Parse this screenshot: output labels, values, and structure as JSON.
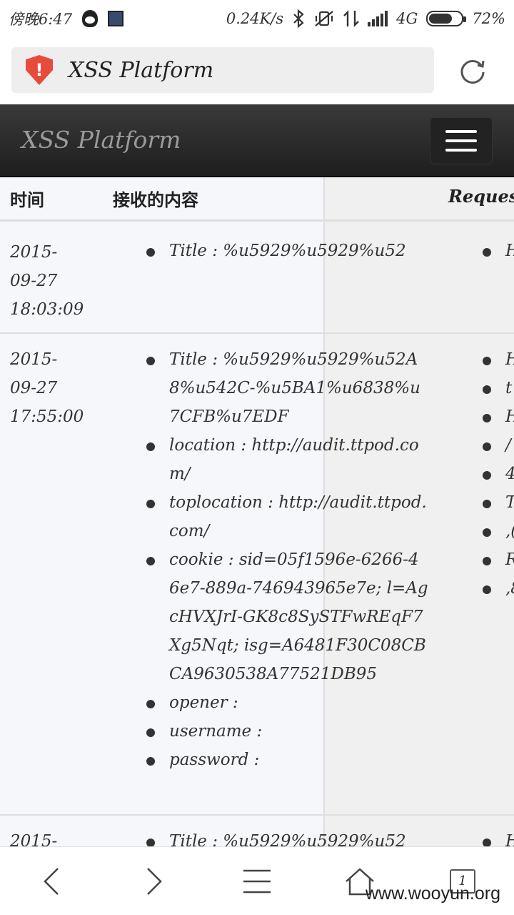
{
  "status_bar": {
    "time": "傍晚6:47",
    "speed": "0.24K/s",
    "network": "4G",
    "battery": "72%",
    "battery_level": 0.72
  },
  "browser": {
    "url_title": "XSS Platform",
    "security_icon": "shield-warning-icon",
    "reload_icon": "reload-icon"
  },
  "app": {
    "brand": "XSS Platform"
  },
  "table": {
    "headers": {
      "time": "时间",
      "content": "接收的内容",
      "request": "Request"
    },
    "rows": [
      {
        "time": [
          "2015-",
          "09-27",
          "18:03:09"
        ],
        "items": [
          "Title : %u5929%u5929%u52"
        ],
        "request_partial": [
          "H"
        ]
      },
      {
        "time": [
          "2015-",
          "09-27",
          "17:55:00"
        ],
        "items": [
          "Title : %u5929%u5929%u52A8%u542C-%u5BA1%u6838%u7CFB%u7EDF",
          "location : http://audit.ttpod.com/",
          "toplocation : http://audit.ttpod.com/",
          "cookie : sid=05f1596e-6266-46e7-889a-746943965e7e; l=AgcHVXJrI-GK8c8SySTFwREqF7Xg5Nqt; isg=A6481F30C08CBCA9630538A77521DB95",
          "opener :",
          "username :",
          "password :"
        ],
        "request_partial": [
          "H",
          "t",
          "H",
          "/",
          "4",
          "T",
          ",(",
          "R",
          ",8"
        ]
      },
      {
        "time": [
          "2015-"
        ],
        "items": [
          "Title : %u5929%u5929%u52"
        ],
        "request_partial": [
          "H"
        ]
      }
    ]
  },
  "bottom_nav": {
    "tabs_count": "1",
    "watermark": "www.wooyun.org"
  }
}
